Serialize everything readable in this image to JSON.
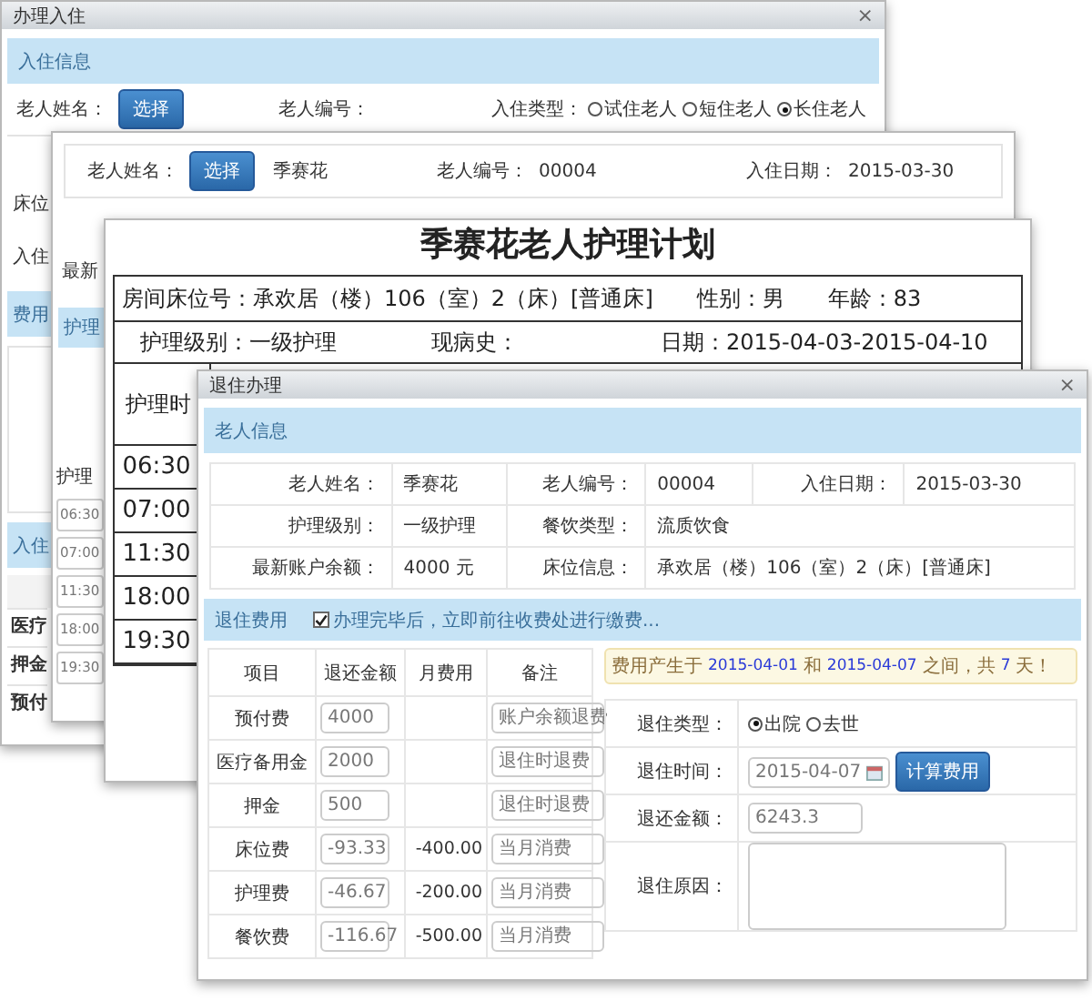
{
  "checkin_window": {
    "title": "办理入住",
    "close": "×",
    "section": "入住信息",
    "name_label": "老人姓名：",
    "select_button": "选择",
    "number_label": "老人编号：",
    "type_label": "入住类型：",
    "types": [
      {
        "label": "试住老人",
        "selected": false
      },
      {
        "label": "短住老人",
        "selected": false
      },
      {
        "label": "长住老人",
        "selected": true
      }
    ],
    "side_labels": [
      "床位",
      "入住"
    ],
    "fee_section": "费用",
    "checkin_fee_section": "入住",
    "fee_rows": [
      "医疗",
      "押金",
      "预付"
    ]
  },
  "care_window": {
    "name_label": "老人姓名：",
    "select_button": "选择",
    "name": "季赛花",
    "number_label": "老人编号：",
    "number": "00004",
    "date_label": "入住日期：",
    "date": "2015-03-30",
    "side_label": "最新",
    "section": "护理",
    "time_label": "护理",
    "times": [
      "06:30",
      "07:00",
      "11:30",
      "18:00",
      "19:30"
    ]
  },
  "care_plan": {
    "title": "季赛花老人护理计划",
    "room": "房间床位号：承欢居（楼）106（室）2（床）[普通床]",
    "gender": "性别：男",
    "age": "年龄：83",
    "level": "护理级别：一级护理",
    "history": "现病史：",
    "dates": "日期：2015-04-03-2015-04-10",
    "time_header": "护理时",
    "times": [
      "06:30",
      "07:00",
      "11:30",
      "18:00",
      "19:30"
    ]
  },
  "checkout_window": {
    "title": "退住办理",
    "close": "×",
    "info_section": "老人信息",
    "info_rows": [
      [
        {
          "label": "老人姓名：",
          "value": "季赛花"
        },
        {
          "label": "老人编号：",
          "value": "00004"
        },
        {
          "label": "入住日期：",
          "value": "2015-03-30"
        }
      ],
      [
        {
          "label": "护理级别：",
          "value": "一级护理"
        },
        {
          "label": "餐饮类型：",
          "value": "流质饮食"
        }
      ],
      [
        {
          "label": "最新账户余额：",
          "value": "4000  元"
        },
        {
          "label": "床位信息：",
          "value": "承欢居（楼）106（室）2（床）[普通床]"
        }
      ]
    ],
    "fee_section": "退住费用",
    "pay_checkbox": {
      "label": "办理完毕后，立即前往收费处进行缴费...",
      "checked": true
    },
    "fee_columns": [
      "项目",
      "退还金额",
      "月费用",
      "备注"
    ],
    "fee_rows": [
      {
        "item": "预付费",
        "refund": "4000",
        "note": "账户余额退费"
      },
      {
        "item": "医疗备用金",
        "refund": "2000",
        "note": "退住时退费"
      },
      {
        "item": "押金",
        "refund": "500",
        "note": "退住时退费"
      },
      {
        "item": "床位费",
        "refund": "-93.33",
        "monthly": "-400.00",
        "note": "当月消费"
      },
      {
        "item": "护理费",
        "refund": "-46.67",
        "monthly": "-200.00",
        "note": "当月消费"
      },
      {
        "item": "餐饮费",
        "refund": "-116.67",
        "monthly": "-500.00",
        "note": "当月消费"
      }
    ],
    "notice": [
      {
        "text": "费用产生于",
        "highlight": false
      },
      {
        "text": "2015-04-01",
        "highlight": true
      },
      {
        "text": "和",
        "highlight": false
      },
      {
        "text": "2015-04-07",
        "highlight": true
      },
      {
        "text": "之间，共",
        "highlight": false
      },
      {
        "text": "7",
        "highlight": true
      },
      {
        "text": "天！",
        "highlight": false
      }
    ],
    "type_label": "退住类型：",
    "types": [
      {
        "label": "出院",
        "selected": true
      },
      {
        "label": "去世",
        "selected": false
      }
    ],
    "time_label": "退住时间：",
    "time_value": "2015-04-07",
    "calc_button": "计算费用",
    "amount_label": "退还金额：",
    "amount": "6243.3",
    "reason_label": "退住原因："
  }
}
